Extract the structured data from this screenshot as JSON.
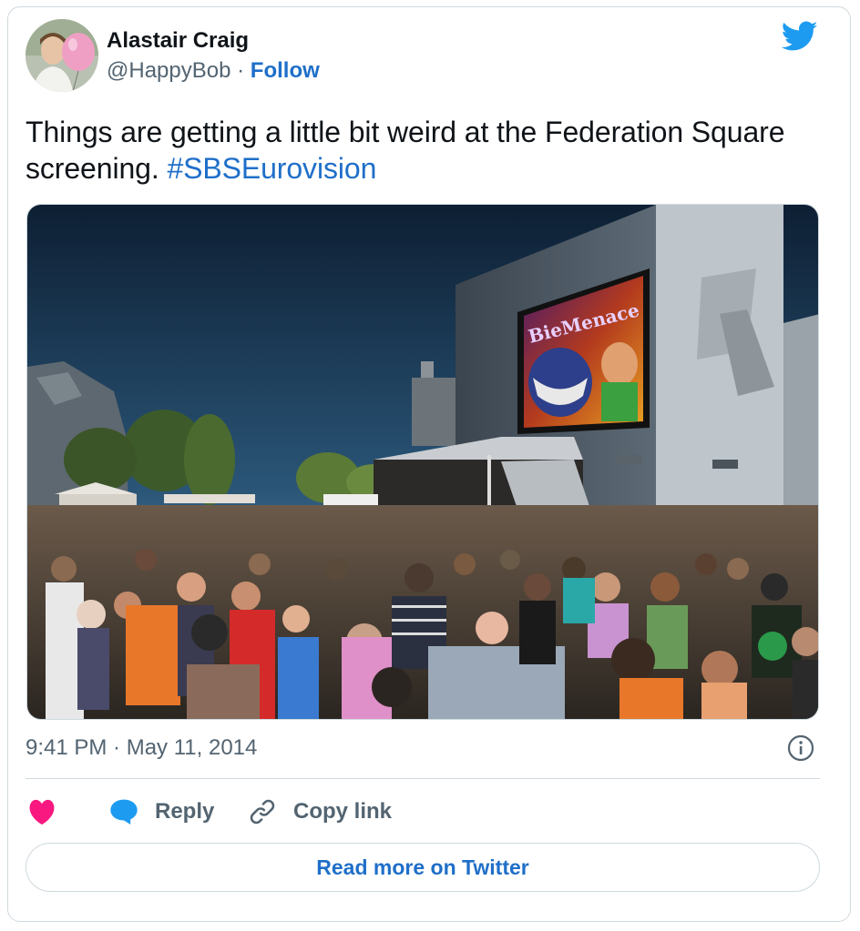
{
  "author": {
    "display_name": "Alastair Craig",
    "handle": "@HappyBob",
    "separator": " · ",
    "follow_label": "Follow"
  },
  "tweet": {
    "text": "Things are getting a little bit weird at the Federation Square screening. ",
    "hashtag": "#SBSEurovision",
    "timestamp": "9:41 PM · May 11, 2014"
  },
  "media": {
    "screen_text": "BieMenace"
  },
  "actions": {
    "reply_label": "Reply",
    "copy_link_label": "Copy link",
    "read_more_label": "Read more on Twitter"
  },
  "icons": {
    "brand": "twitter-bird-icon",
    "like": "heart-icon",
    "reply": "speech-bubble-icon",
    "copy": "link-icon",
    "info": "info-icon"
  },
  "colors": {
    "link": "#1f6fc9",
    "twitter_blue": "#1d9bf0",
    "like": "#f91880",
    "muted_text": "#536471",
    "border": "#cfd9de"
  }
}
